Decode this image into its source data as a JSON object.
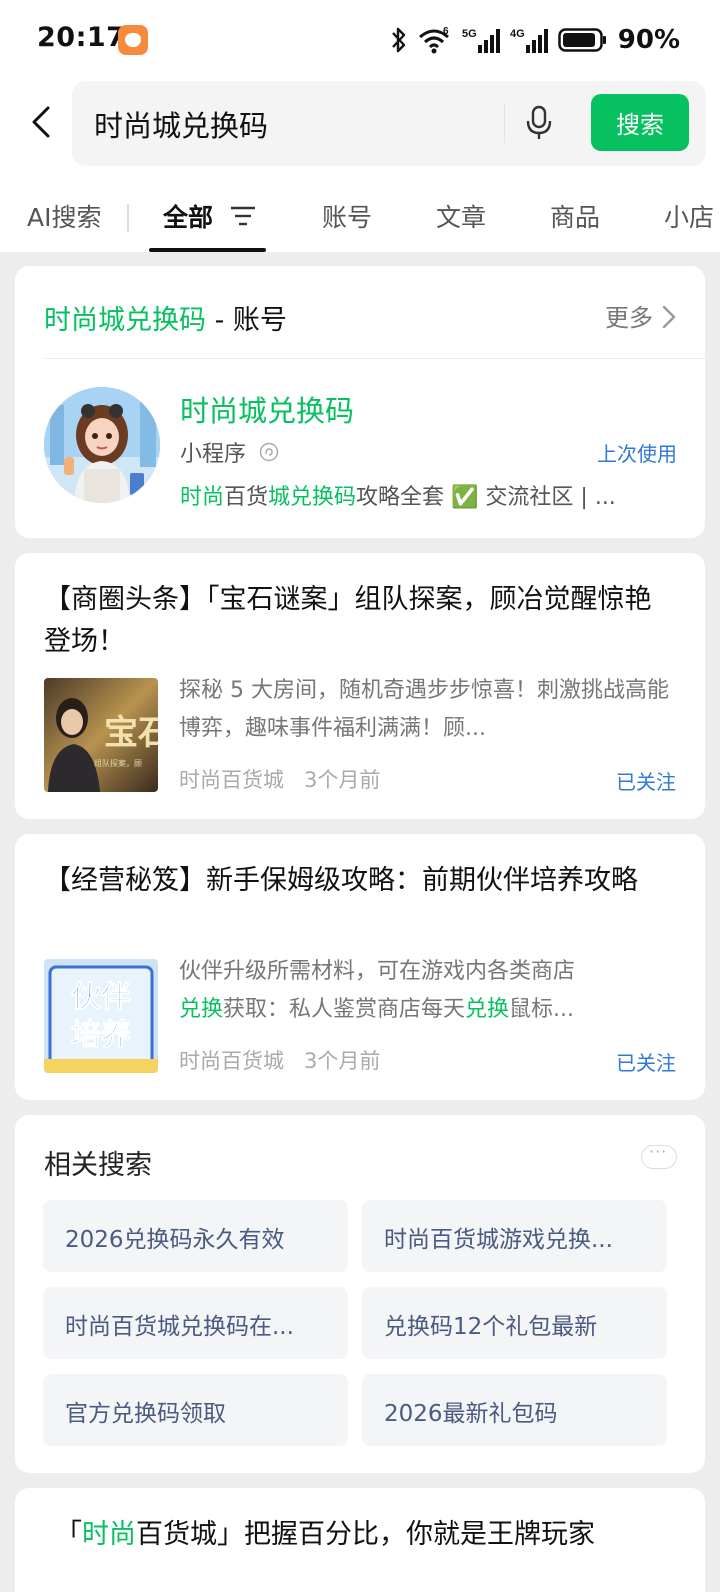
{
  "status_bar": {
    "time": "20:17",
    "battery": "90%",
    "network_5g": "5G",
    "network_4g": "4G",
    "wifi_sup": "6"
  },
  "search": {
    "query": "时尚城兑换码",
    "button_label": "搜索"
  },
  "tabs": [
    {
      "label": "AI搜索"
    },
    {
      "label": "全部",
      "active": true
    },
    {
      "label": "账号"
    },
    {
      "label": "文章"
    },
    {
      "label": "商品"
    },
    {
      "label": "小店"
    }
  ],
  "account_card": {
    "heading_keyword": "时尚城兑换码",
    "heading_suffix": " - 账号",
    "more_label": "更多",
    "name": "时尚城兑换码",
    "type": "小程序",
    "last_used": "上次使用",
    "desc_green1": "时尚",
    "desc_plain1": "百货",
    "desc_green2": "城兑换码",
    "desc_plain2": "攻略全套 ✅ 交流社区 | ..."
  },
  "articles": [
    {
      "title": "【商圈头条】「宝石谜案」组队探案，顾冶觉醒惊艳登场！",
      "desc": "探秘 5 大房间，随机奇遇步步惊喜！刺激挑战高能博弈，趣味事件福利满满！顾...",
      "source": "时尚百货城",
      "time": "3个月前",
      "follow": "已关注",
      "thumb_text": "宝石",
      "thumb_caption": "组队探案，顾"
    },
    {
      "title": "【经营秘笈】新手保姆级攻略：前期伙伴培养攻略",
      "desc_line1": "伙伴升级所需材料，可在游戏内各类商店",
      "desc_green1": "兑换",
      "desc_plain1": "获取：私人鉴赏商店每天",
      "desc_green2": "兑换",
      "desc_plain2": "鼠标...",
      "source": "时尚百货城",
      "time": "3个月前",
      "follow": "已关注",
      "thumb_line1": "伙伴",
      "thumb_line2": "培养"
    }
  ],
  "related": {
    "title": "相关搜索",
    "items": [
      "2026兑换码永久有效",
      "时尚百货城游戏兑换...",
      "时尚百货城兑换码在...",
      "兑换码12个礼包最新",
      "官方兑换码领取",
      "2026最新礼包码"
    ]
  },
  "bottom_article": {
    "open_quote": "「",
    "green": "时尚",
    "rest": "百货城」把握百分比，你就是王牌玩家"
  }
}
